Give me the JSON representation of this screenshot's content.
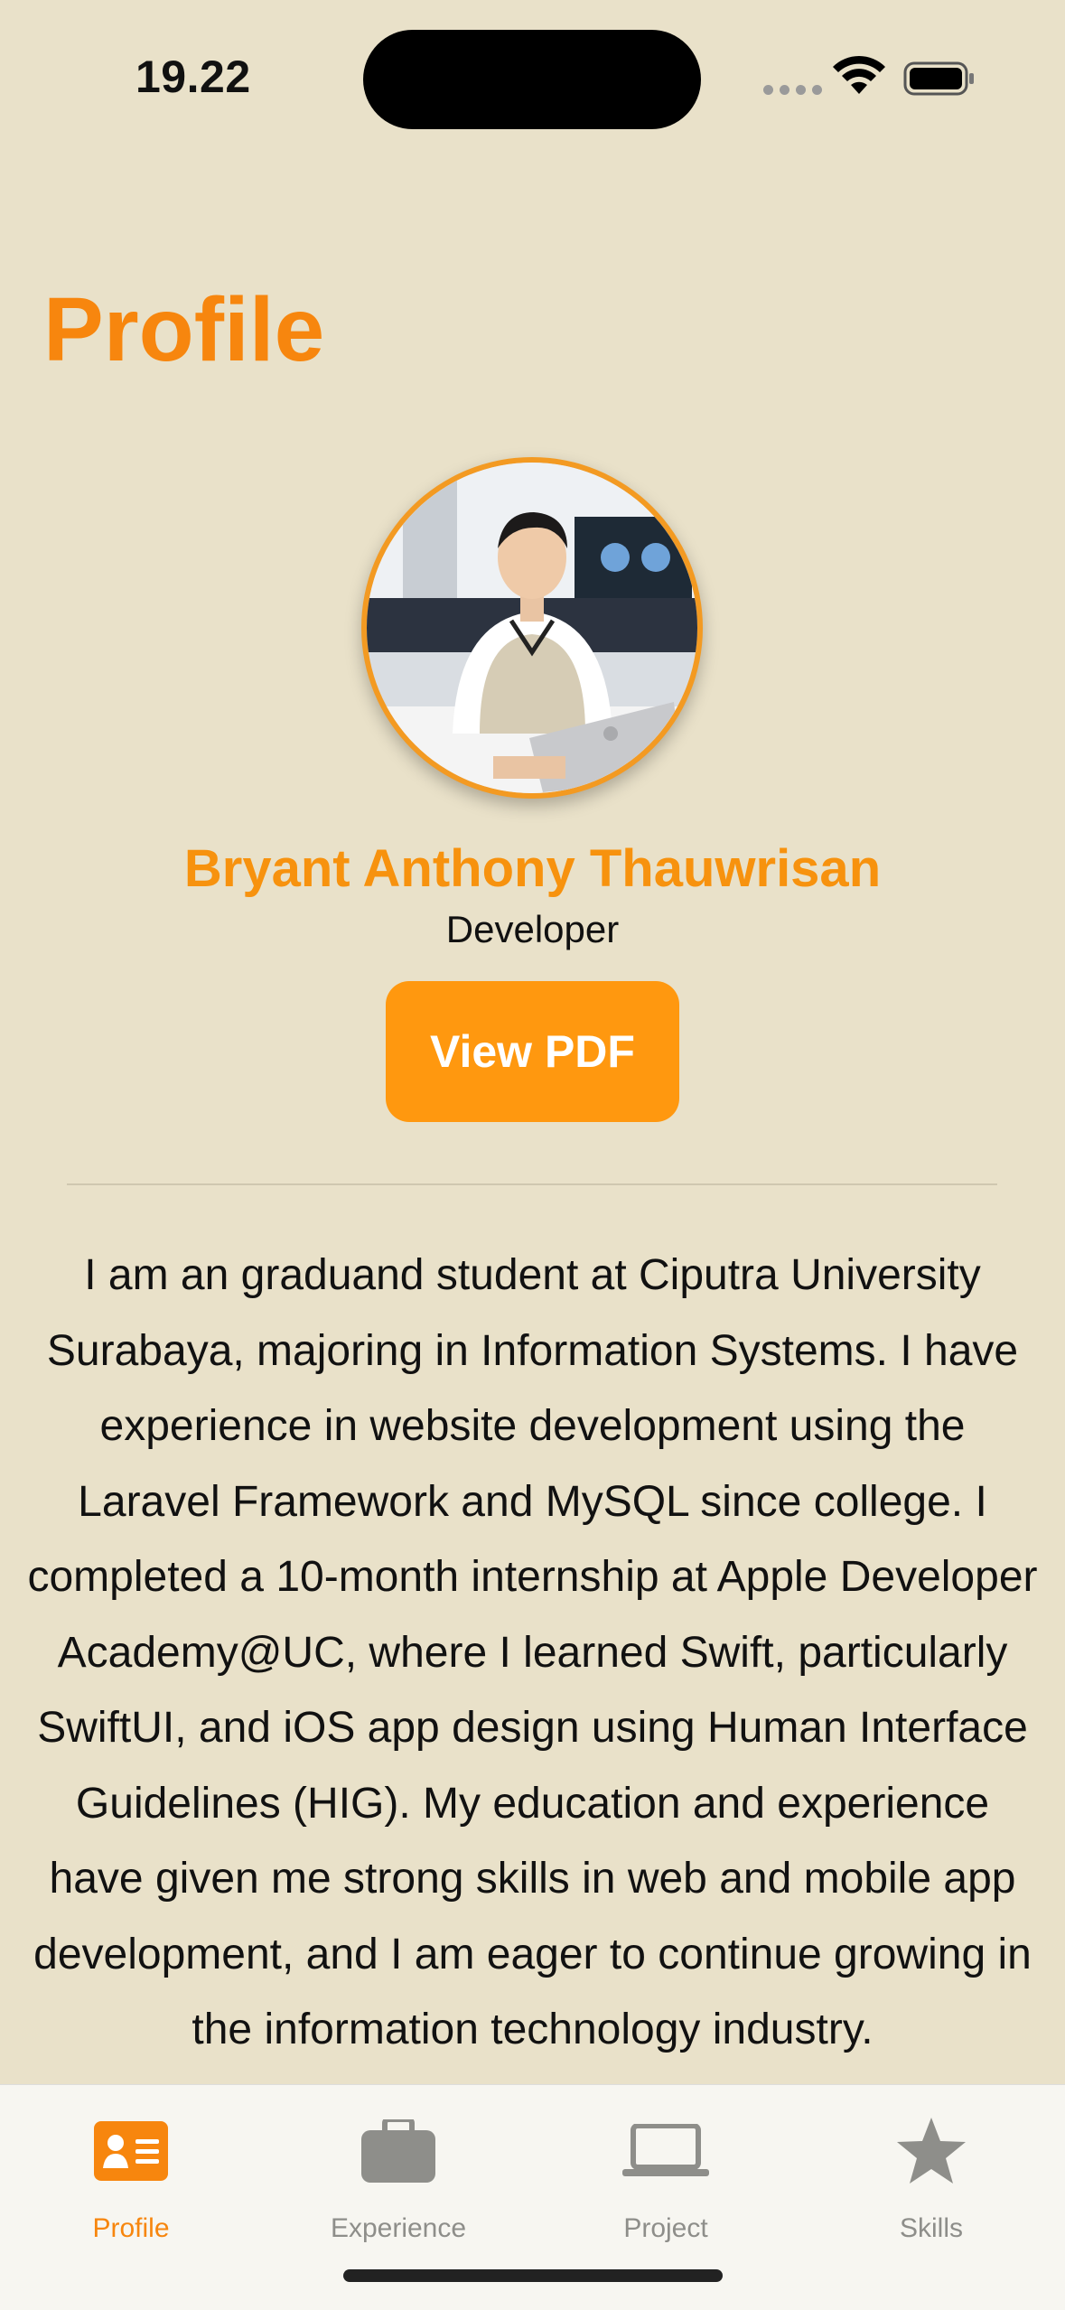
{
  "status_bar": {
    "time": "19.22"
  },
  "page": {
    "title": "Profile"
  },
  "profile": {
    "name": "Bryant Anthony Thauwrisan",
    "role": "Developer",
    "pdf_button_label": "View PDF",
    "bio": "I am an graduand student at Ciputra University Surabaya, majoring in Information Systems. I have experience in website development using the Laravel Framework and MySQL since college. I completed a 10-month internship at Apple Developer Academy@UC, where I learned Swift, particularly SwiftUI, and iOS app design using Human Interface Guidelines (HIG). My education and experience have given me strong skills in web and mobile app development, and I am eager to continue growing in the information technology industry."
  },
  "tabs": [
    {
      "label": "Profile",
      "icon": "person-card-icon",
      "active": true
    },
    {
      "label": "Experience",
      "icon": "briefcase-icon",
      "active": false
    },
    {
      "label": "Project",
      "icon": "laptop-icon",
      "active": false
    },
    {
      "label": "Skills",
      "icon": "star-icon",
      "active": false
    }
  ],
  "colors": {
    "accent": "#F7860E",
    "background": "#E9E1C9",
    "button": "#FF980F",
    "inactive": "#8E8E8A"
  }
}
